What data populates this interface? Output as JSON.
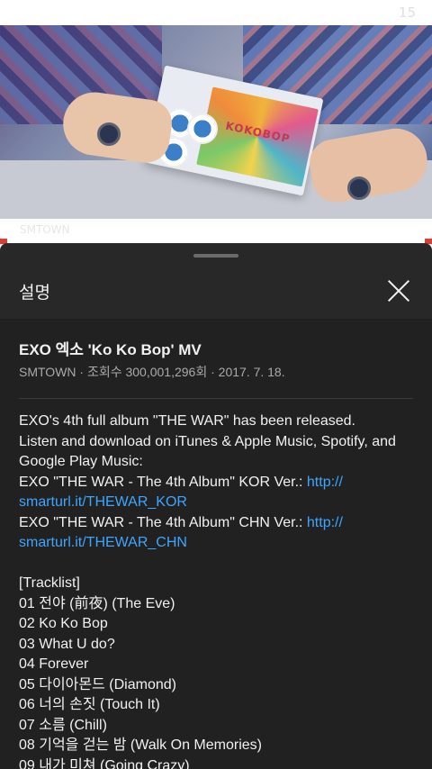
{
  "status": {
    "number": "15"
  },
  "strip": {
    "faded_text": "SMTOWN"
  },
  "sheet": {
    "title": "설명",
    "video_title": "EXO 엑소 'Ko Ko Bop' MV",
    "meta": "SMTOWN · 조회수 300,001,296회 · 2017. 7. 18.",
    "box_text": "KOKOBOP"
  },
  "description": {
    "line1": "EXO's 4th full album \"THE WAR\" has been released.",
    "line2": "Listen and download on iTunes & Apple Music, Spotify, and",
    "line3": "Google Play Music:",
    "kor_prefix": "EXO \"THE WAR - The 4th Album\" KOR Ver.: ",
    "kor_link_a": "http://",
    "kor_link_b": "smarturl.it/THEWAR_KOR",
    "chn_prefix": "EXO \"THE WAR - The 4th Album\" CHN Ver.: ",
    "chn_link_a": "http://",
    "chn_link_b": "smarturl.it/THEWAR_CHN",
    "tracklist_header": "[Tracklist]",
    "tracks": [
      "01 전야 (前夜) (The Eve)",
      "02 Ko Ko Bop",
      "03 What U do?",
      "04 Forever",
      "05 다이아몬드 (Diamond)",
      "06 너의 손짓 (Touch It)",
      "07 소름 (Chill)",
      "08 기억을 걷는 밤 (Walk On Memories)",
      "09 내가 미쳐 (Going Crazy)"
    ]
  },
  "colors": {
    "link": "#3ea6ff",
    "sheet_bg": "#212121",
    "header_bg": "#282828"
  }
}
